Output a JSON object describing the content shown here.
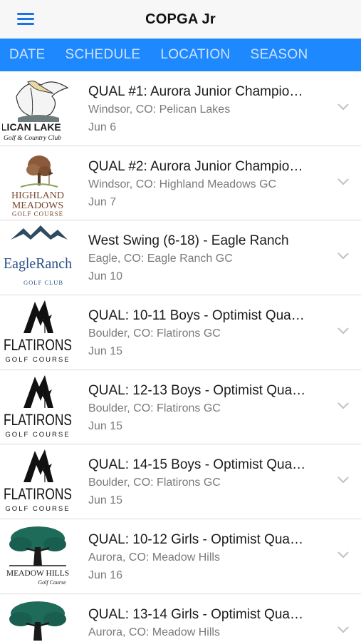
{
  "header": {
    "title": "COPGA Jr",
    "menu_icon": "hamburger-menu-icon"
  },
  "tabs": [
    {
      "label": "DATE"
    },
    {
      "label": "SCHEDULE"
    },
    {
      "label": "LOCATION"
    },
    {
      "label": "SEASON"
    }
  ],
  "colors": {
    "tabbar": "#1e88ff",
    "accent": "#1a73e8"
  },
  "events": [
    {
      "title": "QUAL #1: Aurora Junior Champio…",
      "location": "Windsor, CO: Pelican Lakes",
      "date": "Jun 6",
      "logo": {
        "line1": "LICAN LAKE",
        "line2": "Golf & Country Club"
      }
    },
    {
      "title": "QUAL #2: Aurora Junior Champio…",
      "location": "Windsor, CO: Highland Meadows GC",
      "date": "Jun 7",
      "logo": {
        "line1": "HIGHLAND",
        "line2": "MEADOWS",
        "line3": "GOLF COURSE"
      }
    },
    {
      "title": "West Swing (6-18) - Eagle Ranch",
      "location": "Eagle, CO: Eagle Ranch GC",
      "date": "Jun 10",
      "logo": {
        "line1": "EagleRanch",
        "line2": "GOLF CLUB"
      }
    },
    {
      "title": "QUAL: 10-11 Boys - Optimist Qua…",
      "location": "Boulder, CO: Flatirons GC",
      "date": "Jun 15",
      "logo": {
        "line1": "FLATIRONS",
        "line2": "GOLF COURSE"
      }
    },
    {
      "title": "QUAL: 12-13 Boys - Optimist Qua…",
      "location": "Boulder, CO: Flatirons GC",
      "date": "Jun 15",
      "logo": {
        "line1": "FLATIRONS",
        "line2": "GOLF COURSE"
      }
    },
    {
      "title": "QUAL: 14-15 Boys - Optimist Qua…",
      "location": "Boulder, CO: Flatirons GC",
      "date": "Jun 15",
      "logo": {
        "line1": "FLATIRONS",
        "line2": "GOLF COURSE"
      }
    },
    {
      "title": "QUAL: 10-12 Girls - Optimist Qua…",
      "location": "Aurora, CO: Meadow Hills",
      "date": "Jun 16",
      "logo": {
        "line1": "MEADOW HILLS",
        "line2": "Golf Course"
      }
    },
    {
      "title": "QUAL: 13-14 Girls - Optimist Qua…",
      "location": "Aurora, CO: Meadow Hills",
      "date": "",
      "logo": {
        "line1": "",
        "line2": ""
      }
    }
  ]
}
